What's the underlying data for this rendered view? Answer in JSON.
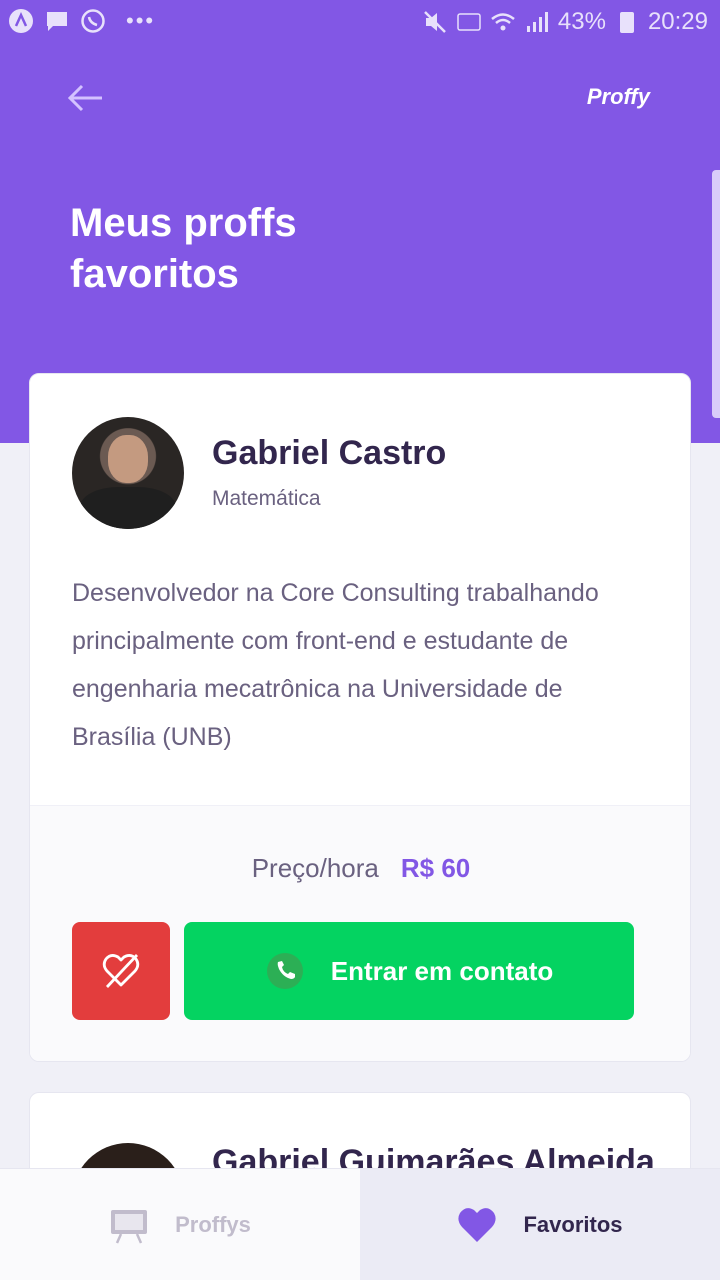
{
  "status_bar": {
    "battery": "43%",
    "time": "20:29",
    "dots": "•••",
    "left_icons": [
      "app-icon",
      "message-icon",
      "whatsapp-icon"
    ],
    "right_icons": [
      "mute-icon",
      "volte-icon",
      "wifi-icon",
      "signal-icon",
      "battery-icon"
    ]
  },
  "header": {
    "back_icon": "arrow-left-icon",
    "brand": "Proffy",
    "title": "Meus proffs favoritos"
  },
  "teachers": [
    {
      "name": "Gabriel Castro",
      "subject": "Matemática",
      "bio": "Desenvolvedor na Core Consulting trabalhando principalmente com front-end e estudante de engenharia mecatrônica na Universidade de Brasília (UNB)",
      "price_label": "Preço/hora",
      "price_value": "R$ 60",
      "unfavorite_icon": "heart-outline-crossed-icon",
      "contact_label": "Entrar em contato",
      "contact_icon": "whatsapp-icon"
    },
    {
      "name": "Gabriel Guimarães Almeida"
    }
  ],
  "tabs": [
    {
      "label": "Proffys",
      "icon": "easel-icon",
      "active": false
    },
    {
      "label": "Favoritos",
      "icon": "heart-icon",
      "active": true
    }
  ],
  "colors": {
    "primary": "#8257e5",
    "danger": "#e33d3d",
    "success": "#04d361",
    "title": "#32264d",
    "text": "#6a6180"
  }
}
